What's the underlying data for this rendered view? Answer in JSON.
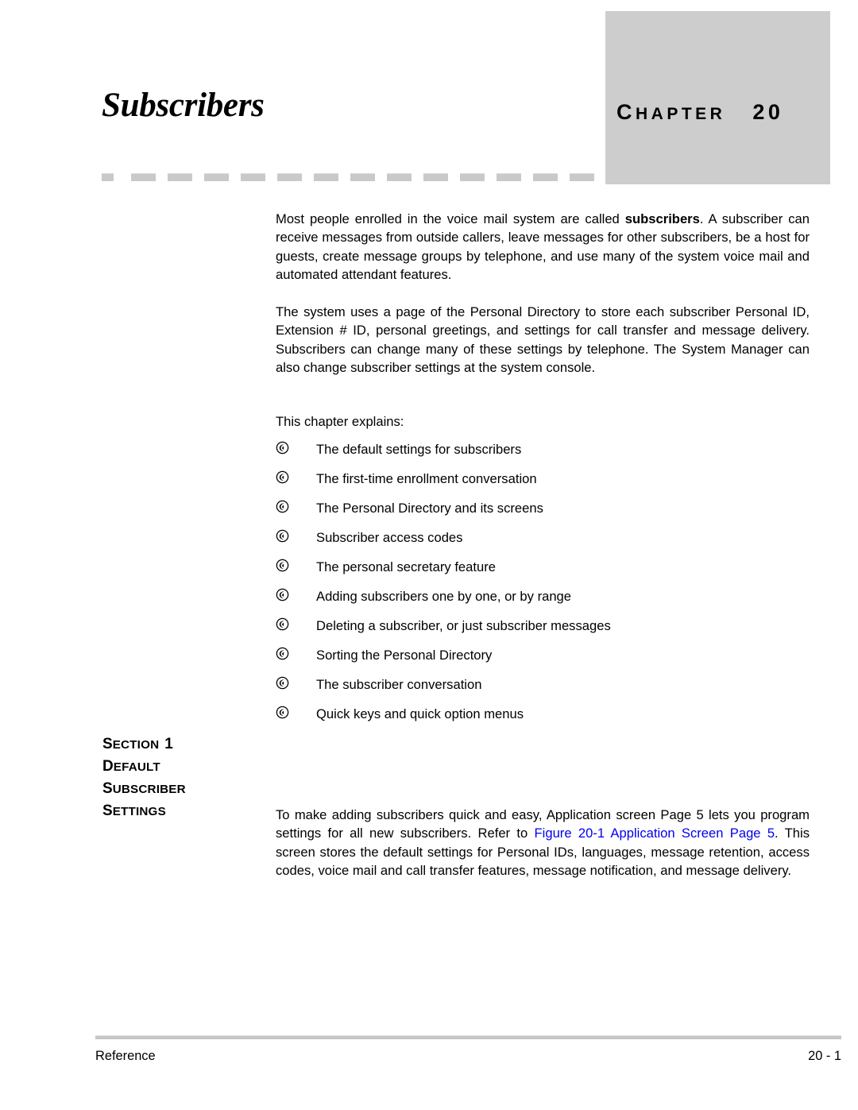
{
  "header": {
    "title": "Subscribers",
    "chapter_word_first": "C",
    "chapter_word_rest": "HAPTER",
    "chapter_number": "20",
    "chapter_box_color": "#cdcdcd"
  },
  "intro": {
    "paragraph_1_pre": "Most people enrolled in the voice mail system are called ",
    "paragraph_1_bold": "subscribers",
    "paragraph_1_post": ". A subscriber can receive messages from outside callers, leave messages for other subscribers, be a host for guests, create message groups by telephone, and use many of the system voice mail and automated attendant features.",
    "paragraph_2": "The system uses a page of the Personal Directory to store each subscriber Personal ID, Extension # ID, personal greetings, and settings for call transfer and message delivery. Subscribers can change many of these settings by telephone. The System Manager can also change subscriber settings at the system console.",
    "explains_lead": "This chapter explains:"
  },
  "bullets": [
    {
      "bullet_icon": "circled-phone-bullet-icon",
      "text": "The default settings for subscribers"
    },
    {
      "bullet_icon": "circled-phone-bullet-icon",
      "text": "The first-time enrollment conversation"
    },
    {
      "bullet_icon": "circled-phone-bullet-icon",
      "text": "The Personal Directory and its screens"
    },
    {
      "bullet_icon": "circled-phone-bullet-icon",
      "text": "Subscriber access codes"
    },
    {
      "bullet_icon": "circled-phone-bullet-icon",
      "text": "The personal secretary feature"
    },
    {
      "bullet_icon": "circled-phone-bullet-icon",
      "text": "Adding subscribers one by one, or by range"
    },
    {
      "bullet_icon": "circled-phone-bullet-icon",
      "text": "Deleting a subscriber, or just subscriber messages"
    },
    {
      "bullet_icon": "circled-phone-bullet-icon",
      "text": "Sorting the Personal Directory"
    },
    {
      "bullet_icon": "circled-phone-bullet-icon",
      "text": "The subscriber conversation"
    },
    {
      "bullet_icon": "circled-phone-bullet-icon",
      "text": "Quick keys and quick option menus"
    }
  ],
  "section": {
    "line1_first": "S",
    "line1_rest": "ECTION",
    "line1_num": "1",
    "line2_first": "D",
    "line2_rest": "EFAULT",
    "line3_first": "S",
    "line3_rest": "UBSCRIBER",
    "line4_first": "S",
    "line4_rest": "ETTINGS"
  },
  "section_body": {
    "part_1": "To make adding subscribers quick and easy, Application screen Page 5 lets you program settings for all new subscribers. Refer to ",
    "link_text": "Figure 20-1 Application Screen Page 5",
    "part_2": ". This screen stores the default settings for Personal IDs, languages, message retention, access codes, voice mail and call transfer features, message notification, and message delivery.",
    "link_color": "#0000ee"
  },
  "footer": {
    "left": "Reference",
    "right": "20 - 1"
  }
}
